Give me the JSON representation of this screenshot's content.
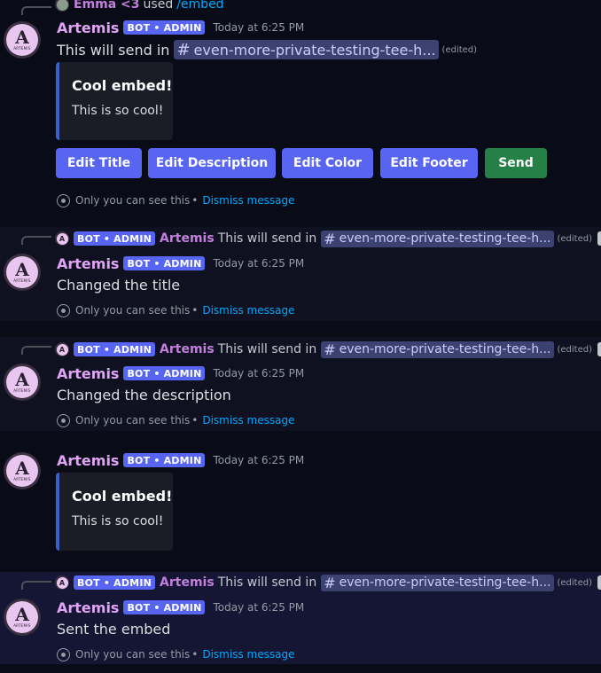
{
  "bot": {
    "name": "Artemis",
    "tag": "BOT • ADMIN",
    "avatar_letter": "A",
    "avatar_sub": "ARTEMIS"
  },
  "messages": [
    {
      "reply_user": "Emma <3",
      "reply_used": "used",
      "reply_command": "/embed",
      "timestamp": "Today at 6:25 PM",
      "content_prefix": "This will send in",
      "channel": "even-more-private-testing-tee-h...",
      "edited": "(edited)",
      "embed": {
        "title": "Cool embed!",
        "description": "This is so cool!"
      },
      "buttons": [
        "Edit Title",
        "Edit Description",
        "Edit Color",
        "Edit Footer",
        "Send"
      ],
      "ephemeral": "Only you can see this",
      "dismiss": "Dismiss message"
    },
    {
      "reply_text": "This will send in",
      "reply_channel": "even-more-private-testing-tee-h...",
      "reply_edited": "(edited)",
      "timestamp": "Today at 6:25 PM",
      "content": "Changed the title",
      "ephemeral": "Only you can see this",
      "dismiss": "Dismiss message"
    },
    {
      "reply_text": "This will send in",
      "reply_channel": "even-more-private-testing-tee-h...",
      "reply_edited": "(edited)",
      "timestamp": "Today at 6:25 PM",
      "content": "Changed the description",
      "ephemeral": "Only you can see this",
      "dismiss": "Dismiss message"
    },
    {
      "timestamp": "Today at 6:25 PM",
      "embed": {
        "title": "Cool embed!",
        "description": "This is so cool!"
      }
    },
    {
      "reply_text": "This will send in",
      "reply_channel": "even-more-private-testing-tee-h...",
      "reply_edited": "(edited)",
      "timestamp": "Today at 6:25 PM",
      "content": "Sent the embed",
      "ephemeral": "Only you can see this",
      "dismiss": "Dismiss message"
    }
  ],
  "icons": {
    "channel_hash": "#",
    "slash_command": "/",
    "eye": "eye-icon"
  },
  "colors": {
    "blurple": "#5865f2",
    "send_green": "#248046",
    "bot_name": "#e0a4f5",
    "link": "#00a8fc"
  }
}
